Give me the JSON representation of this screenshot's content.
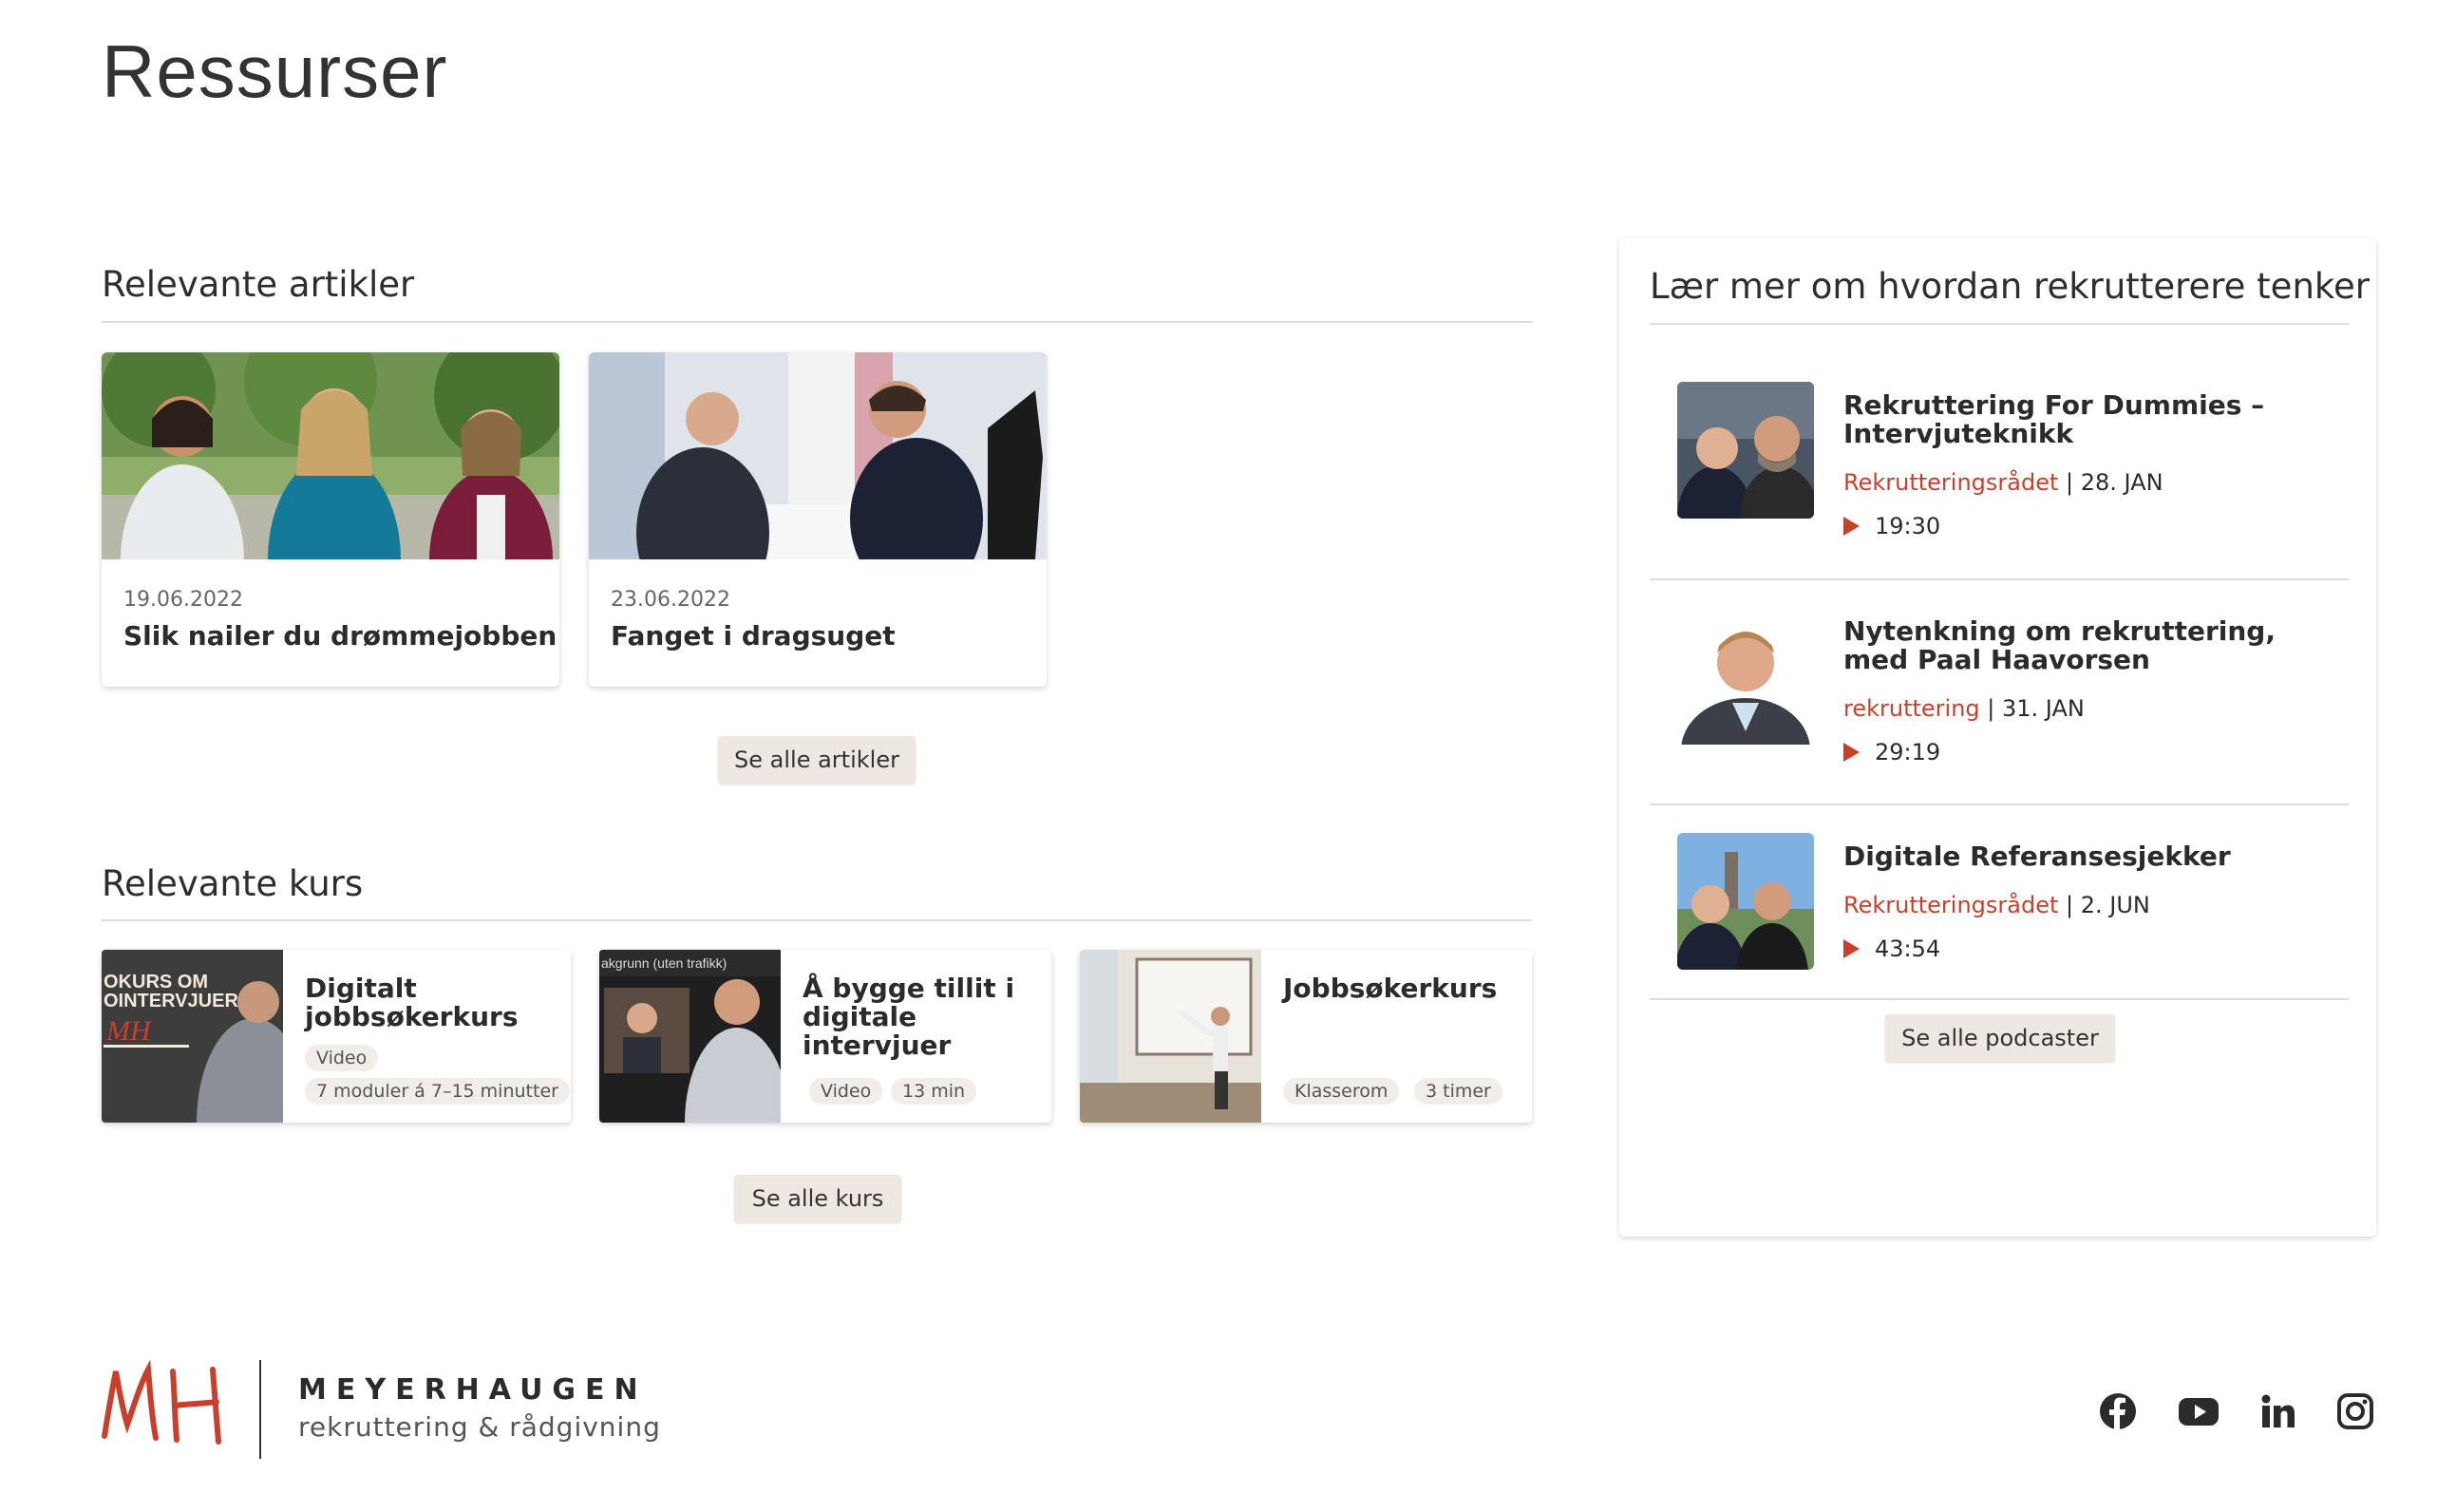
{
  "page": {
    "title": "Ressurser"
  },
  "articles": {
    "heading": "Relevante artikler",
    "items": [
      {
        "date": "19.06.2022",
        "title": "Slik nailer du drømmejobben"
      },
      {
        "date": "23.06.2022",
        "title": "Fanget i dragsuget"
      }
    ],
    "more_label": "Se alle artikler"
  },
  "courses": {
    "heading": "Relevante kurs",
    "items": [
      {
        "title": "Digitalt jobbsøkerkurs",
        "tags": [
          "Video",
          "7 moduler á 7–15 minutter"
        ],
        "thumb_text": [
          "OKURS OM",
          "OINTERVJUER"
        ]
      },
      {
        "title": "Å bygge tillit i digitale intervjuer",
        "tags": [
          "Video",
          "13 min"
        ],
        "thumb_text": [
          "akgrunn (uten trafikk)"
        ]
      },
      {
        "title": "Jobbsøkerkurs",
        "tags": [
          "Klasserom",
          "3 timer"
        ]
      }
    ],
    "more_label": "Se alle kurs"
  },
  "podcasts": {
    "heading": "Lær mer om hvordan rekrutterere tenker",
    "items": [
      {
        "title": "Rekruttering For Dummies – Intervjuteknikk",
        "category": "Rekrutteringsrådet",
        "date": "| 28. JAN",
        "duration": "19:30"
      },
      {
        "title": "Nytenkning om rekruttering, med Paal Haavorsen",
        "category": "rekruttering",
        "date": "| 31. JAN",
        "duration": "29:19"
      },
      {
        "title": "Digitale Referansesjekker",
        "category": "Rekrutteringsrådet",
        "date": "| 2. JUN",
        "duration": "43:54"
      }
    ],
    "more_label": "Se alle podcaster"
  },
  "footer": {
    "logo_mark": "MH",
    "brand_name": "MEYERHAUGEN",
    "brand_tagline": "rekruttering & rådgivning",
    "social": [
      "facebook-icon",
      "youtube-icon",
      "linkedin-icon",
      "instagram-icon"
    ]
  },
  "colors": {
    "accent": "#c8402c",
    "button_bg": "#ede8e2",
    "tag_bg": "#f1ede8"
  }
}
